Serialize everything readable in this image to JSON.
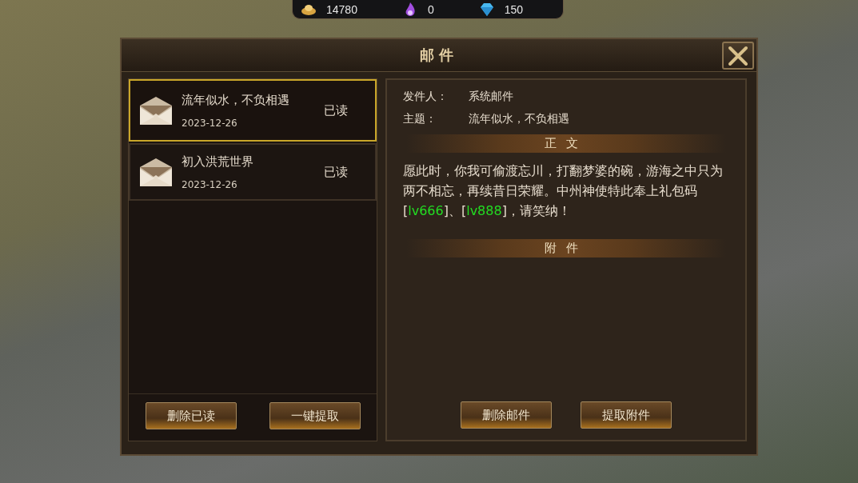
{
  "resources": [
    {
      "kind": "gold",
      "value": "14780"
    },
    {
      "kind": "crystal",
      "value": "0"
    },
    {
      "kind": "diamond",
      "value": "150"
    }
  ],
  "dialog": {
    "title": "邮件",
    "mails": [
      {
        "subject": "流年似水，不负相遇",
        "date": "2023-12-26",
        "status": "已读",
        "selected": true
      },
      {
        "subject": "初入洪荒世界",
        "date": "2023-12-26",
        "status": "已读",
        "selected": false
      }
    ],
    "list_buttons": [
      "删除已读",
      "一键提取"
    ],
    "detail": {
      "sender_label": "发件人：",
      "sender": "系统邮件",
      "subject_label": "主题：",
      "subject": "流年似水，不负相遇",
      "body_heading": "正文",
      "body": [
        {
          "kind": "plain",
          "text": "愿此时，你我可偷渡忘川，打翻梦婆的碗，游海之中只为两不相忘，再续昔日荣耀。中州神使特此奉上礼包码["
        },
        {
          "kind": "code",
          "text": "lv666"
        },
        {
          "kind": "plain",
          "text": "]、["
        },
        {
          "kind": "code",
          "text": "lv888"
        },
        {
          "kind": "plain",
          "text": "]，请笑纳！"
        }
      ],
      "attachments_heading": "附件",
      "buttons": [
        "删除邮件",
        "提取附件"
      ]
    }
  }
}
